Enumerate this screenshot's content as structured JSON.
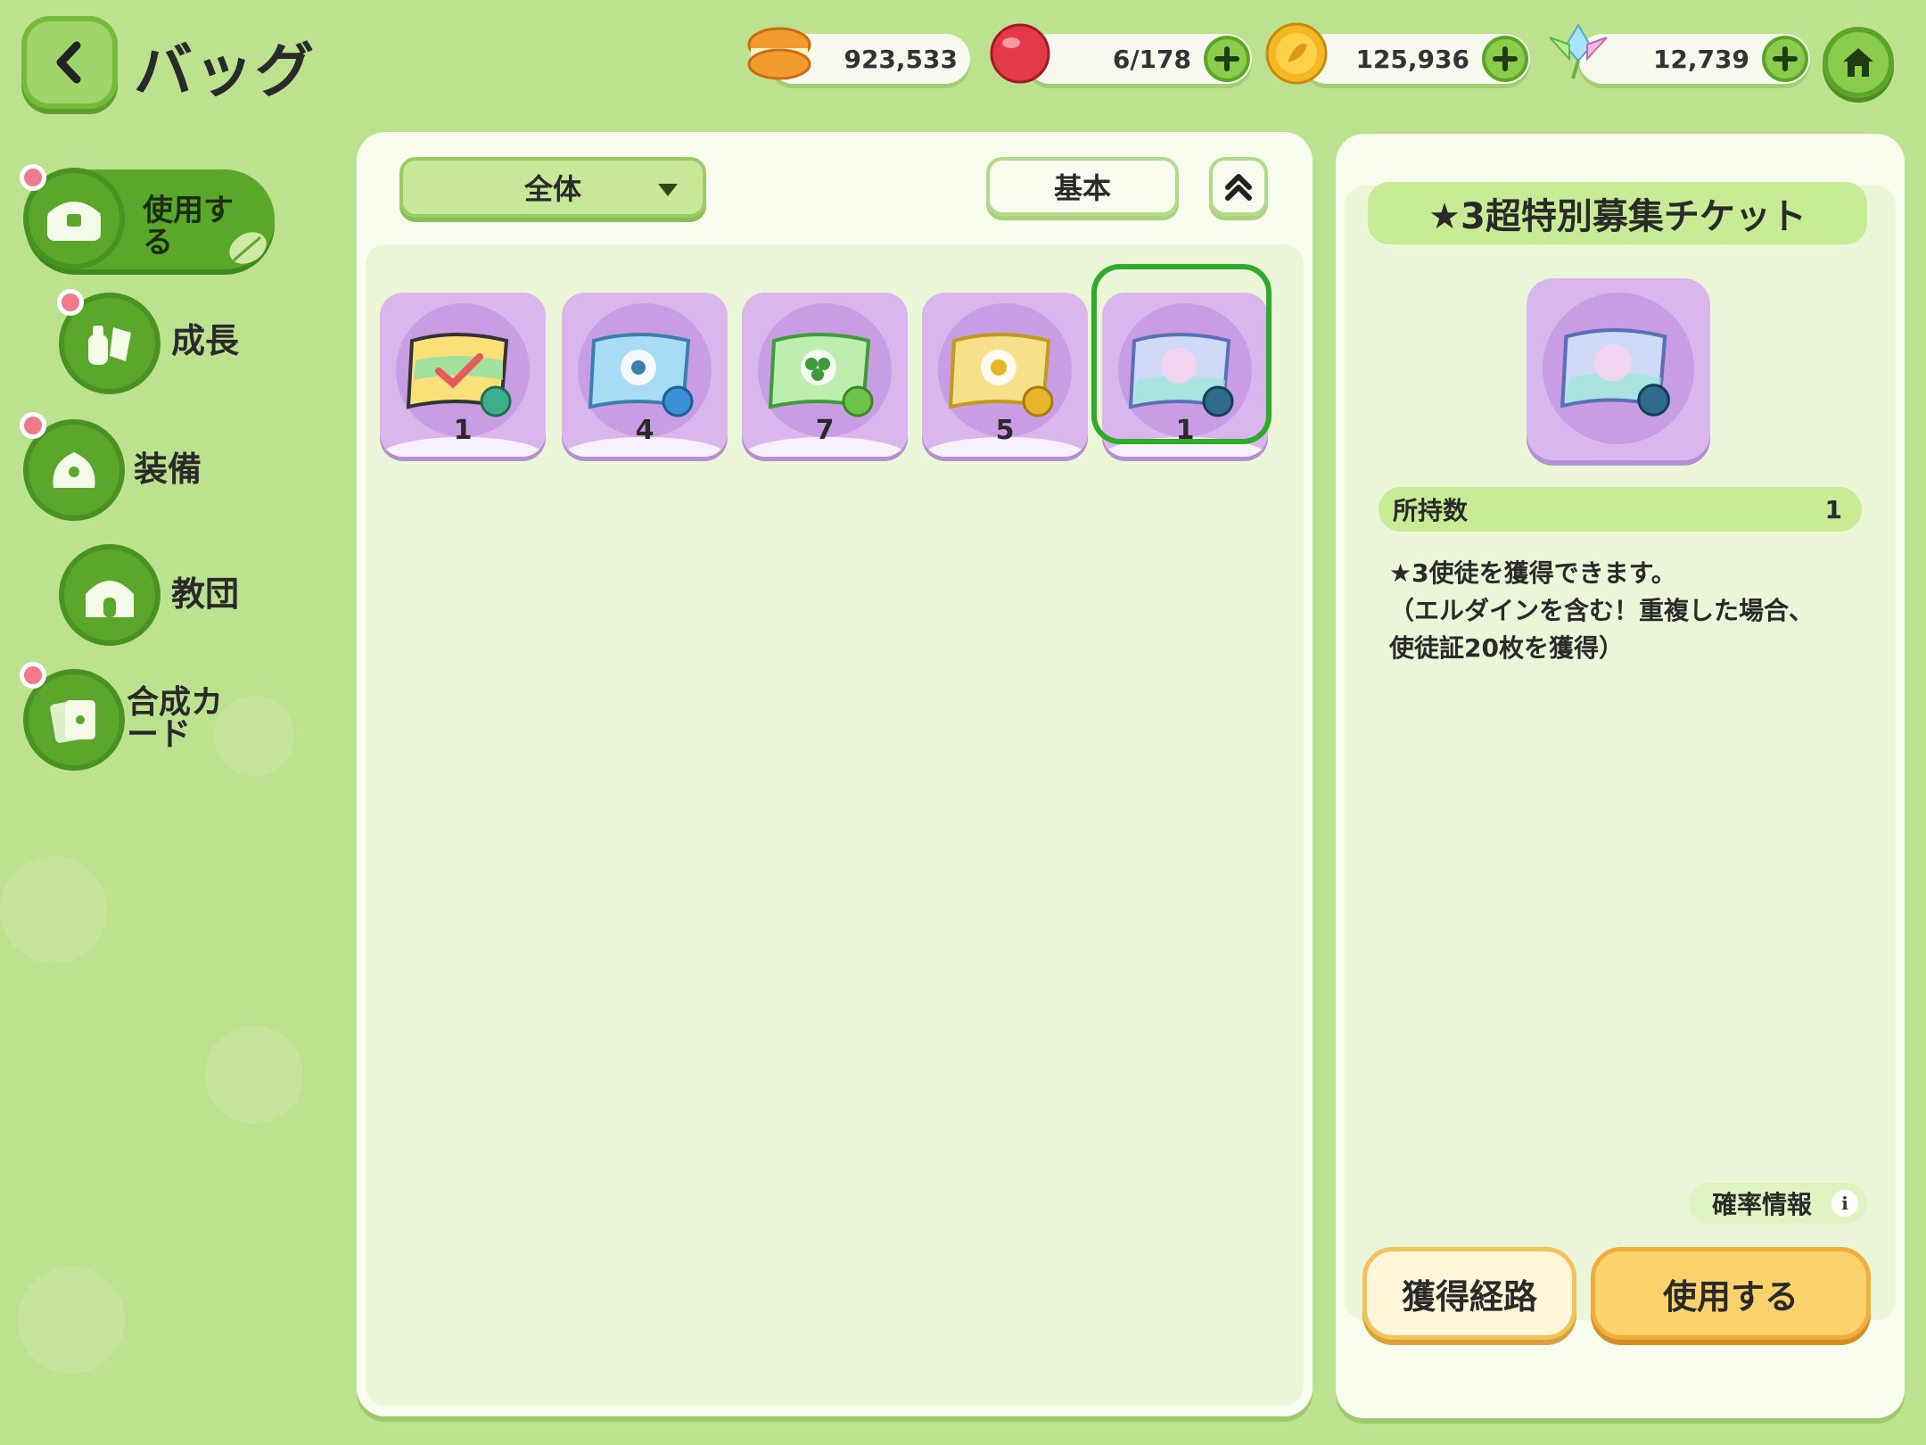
{
  "header": {
    "title": "バッグ",
    "resources": [
      {
        "icon": "macaron-icon",
        "value": "923,533"
      },
      {
        "icon": "candy-icon",
        "value": "6/178"
      },
      {
        "icon": "gold-coin-icon",
        "value": "125,936"
      },
      {
        "icon": "crystal-icon",
        "value": "12,739"
      }
    ]
  },
  "sidebar": {
    "items": [
      {
        "label": "使用する",
        "icon": "treasure-chest-icon",
        "active": true
      },
      {
        "label": "成長",
        "icon": "potion-icon",
        "active": false
      },
      {
        "label": "装備",
        "icon": "equipment-icon",
        "active": false
      },
      {
        "label": "教団",
        "icon": "chapel-icon",
        "active": false
      },
      {
        "label": "合成カード",
        "icon": "card-icon",
        "active": false
      }
    ]
  },
  "inventory": {
    "filter": "全体",
    "sort": "基本",
    "items": [
      {
        "name": "rainbow-ticket",
        "count": "1",
        "color": "#f5c13b"
      },
      {
        "name": "blue-ticket",
        "count": "4",
        "color": "#7cc4ec"
      },
      {
        "name": "green-ticket",
        "count": "7",
        "color": "#8ed97c"
      },
      {
        "name": "gold-ticket",
        "count": "5",
        "color": "#f2d36a"
      },
      {
        "name": "star3-super-special-ticket",
        "count": "1",
        "color": "#b9c8f0"
      }
    ],
    "selected_index": 4
  },
  "detail": {
    "title": "★3超特別募集チケット",
    "owned_label": "所持数",
    "owned_value": "1",
    "description": [
      "★3使徒を獲得できます。",
      "（エルダインを含む！重複した場合、",
      "使徒証20枚を獲得）"
    ],
    "rate_info": "確率情報",
    "acquire_label": "獲得経路",
    "use_label": "使用する"
  }
}
